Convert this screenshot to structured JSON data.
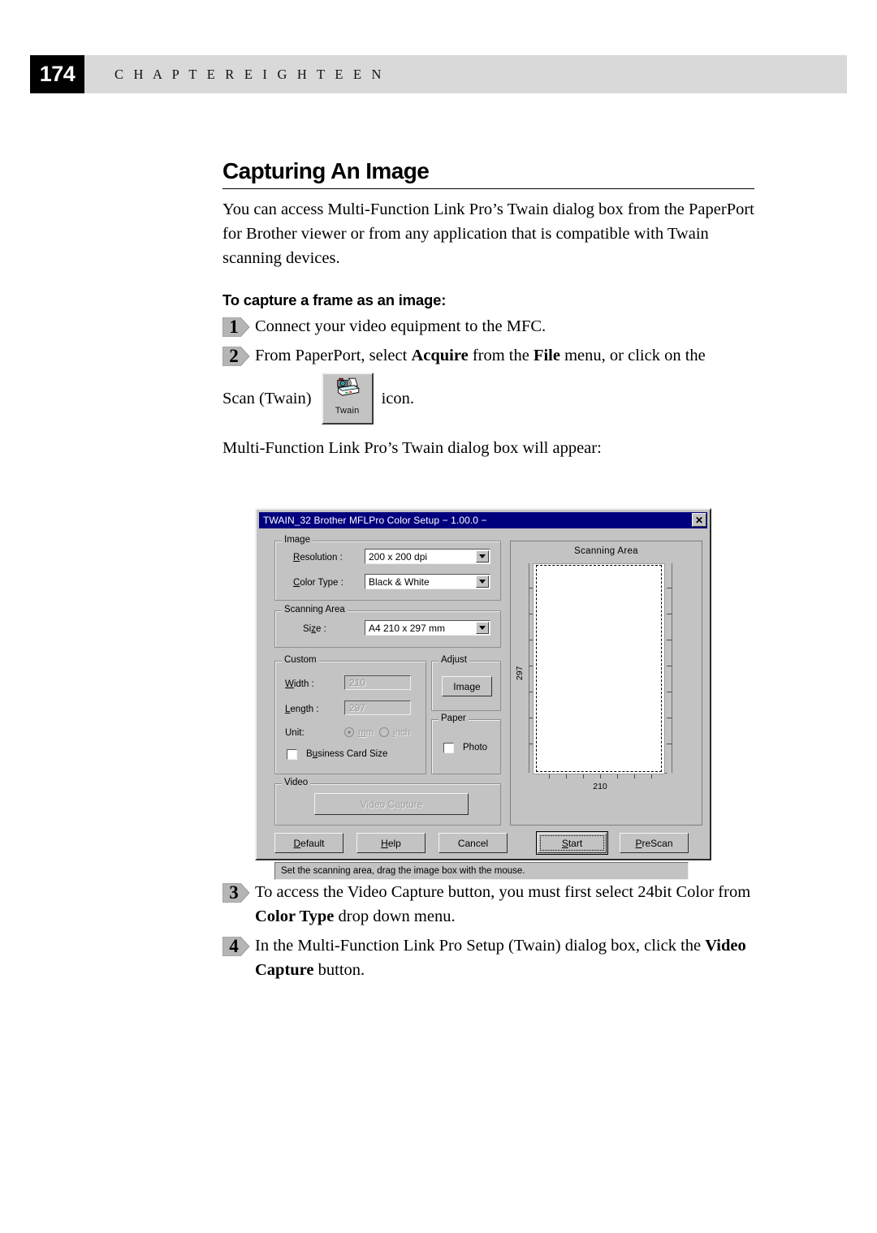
{
  "header": {
    "page_number": "174",
    "chapter_label": "C H A P T E R   E I G H T E E N"
  },
  "section": {
    "title": "Capturing An Image",
    "intro": "You can access Multi-Function Link Pro’s Twain dialog box from the PaperPort for Brother viewer or from any application that is compatible with Twain scanning devices.",
    "sub_head": "To capture a frame as an image:"
  },
  "steps": [
    {
      "number": "1",
      "text": "Connect your video equipment to the MFC."
    },
    {
      "number": "2",
      "text_before": "From PaperPort, select ",
      "bold_1": "Acquire",
      "text_mid": " from the ",
      "bold_2": "File",
      "text_after": " menu, or click on the"
    },
    {
      "number": "3",
      "text_before": "To access the Video Capture button, you must first select 24bit Color from ",
      "bold_1": "Color Type",
      "text_after": " drop down menu."
    },
    {
      "number": "4",
      "text_before": "In the Multi-Function Link Pro Setup (Twain) dialog box, click the ",
      "bold_1": "Video Capture",
      "text_after": " button."
    }
  ],
  "icon_line": {
    "prefix": "Scan (Twain)",
    "icon_caption": "Twain",
    "suffix": "icon."
  },
  "dialog_caption": "Multi-Function Link Pro’s Twain dialog box will appear:",
  "dialog": {
    "title": "TWAIN_32 Brother  MFLPro Color Setup  −  1.00.0  −",
    "close_glyph": "✕",
    "groups": {
      "image": {
        "legend": "Image",
        "resolution_label": "Resolution :",
        "resolution_accel": "R",
        "resolution_value": "200 x 200 dpi",
        "color_type_label": "Color Type :",
        "color_type_accel": "C",
        "color_type_value": "Black & White"
      },
      "scanning_area": {
        "legend": "Scanning Area",
        "size_label": "Size :",
        "size_accel": "z",
        "size_value": "A4 210 x 297 mm"
      },
      "custom": {
        "legend": "Custom",
        "width_label": "Width :",
        "width_accel": "W",
        "width_value": "210",
        "length_label": "Length :",
        "length_accel": "L",
        "length_value": "297",
        "unit_label": "Unit:",
        "unit_mm": "mm",
        "unit_inch": "inch",
        "unit_selected": "mm",
        "business_card_label": "Business Card Size",
        "business_card_checked": false
      },
      "adjust": {
        "legend": "Adjust",
        "image_button": "Image"
      },
      "paper": {
        "legend": "Paper",
        "photo_label": "Photo",
        "photo_checked": false
      },
      "video": {
        "legend": "Video",
        "video_capture_button": "Video Capture",
        "video_capture_enabled": false
      }
    },
    "preview": {
      "title": "Scanning Area",
      "height_label": "297",
      "width_label": "210"
    },
    "buttons": {
      "default": "Default",
      "default_accel": "D",
      "help": "Help",
      "help_accel": "H",
      "cancel": "Cancel",
      "start": "Start",
      "start_accel": "S",
      "prescan": "PreScan",
      "prescan_accel": "P"
    },
    "status_text": "Set the scanning area, drag the image box with the mouse.",
    "colors": {
      "titlebar": "#00007e",
      "face": "#c3c3c3",
      "shadow": "#2f2f2f",
      "highlight": "#f5f5f5"
    }
  }
}
